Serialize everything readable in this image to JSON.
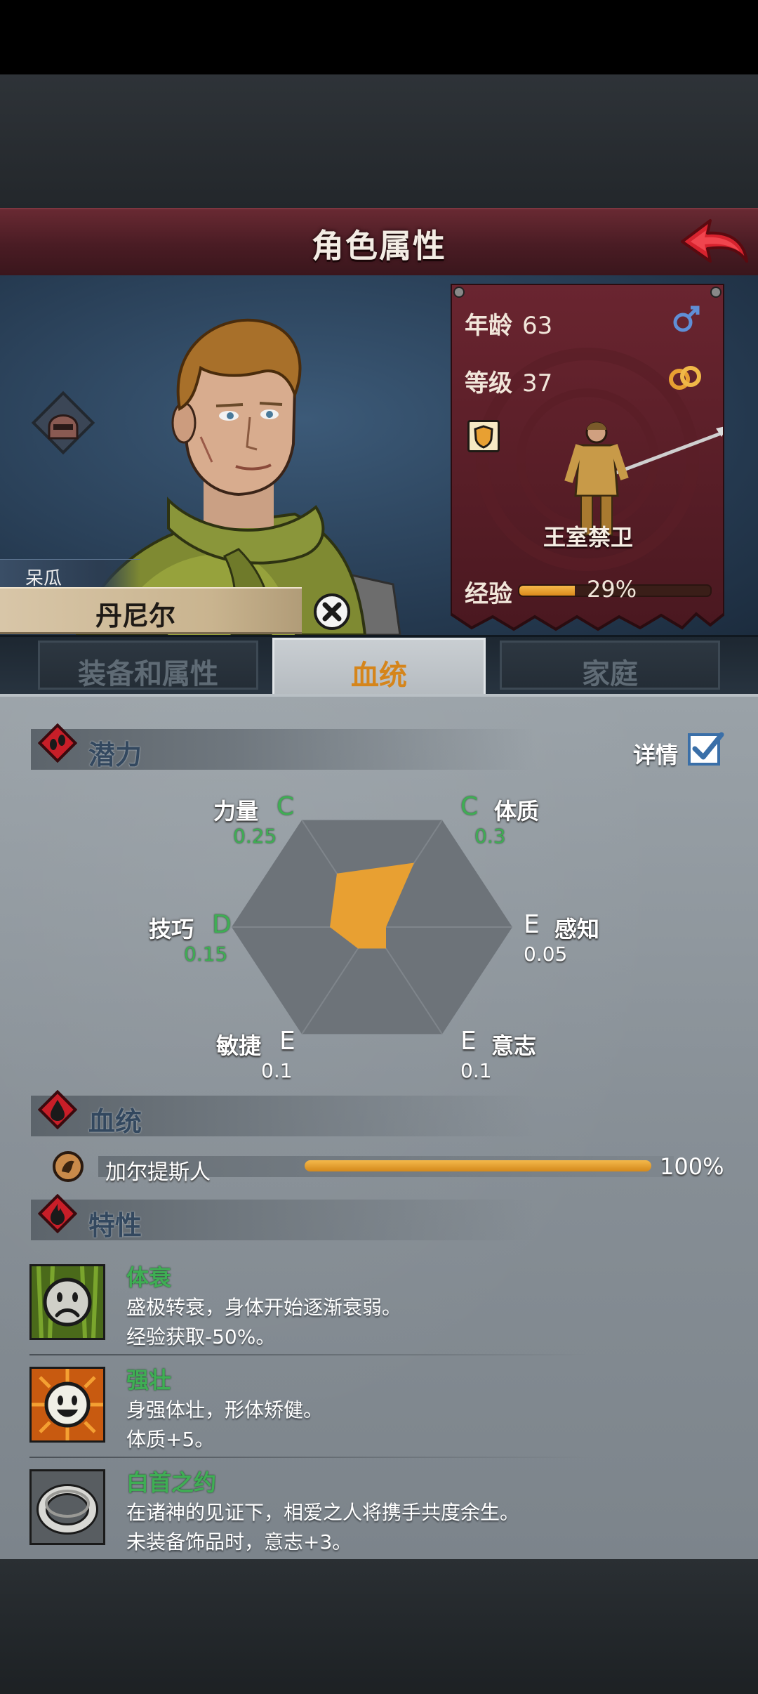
{
  "header": {
    "title": "角色属性",
    "back_icon": "red-arrow-back-icon"
  },
  "character": {
    "nickname": "呆瓜",
    "name": "丹尼尔",
    "age_label": "年龄",
    "age": "63",
    "gender_icon": "male-symbol-icon",
    "level_label": "等级",
    "level": "37",
    "ring_icon": "wedding-rings-icon",
    "class_name": "王室禁卫",
    "exp_label": "经验",
    "exp_percent": "29%",
    "exp_fraction": 0.29
  },
  "tabs": [
    {
      "label": "装备和属性",
      "active": false
    },
    {
      "label": "血统",
      "active": true
    },
    {
      "label": "家庭",
      "active": false
    }
  ],
  "potential": {
    "title": "潜力",
    "details_label": "详情",
    "details_checked": true,
    "stats": [
      {
        "name": "力量",
        "grade": "C",
        "value": "0.25"
      },
      {
        "name": "体质",
        "grade": "C",
        "value": "0.3"
      },
      {
        "name": "感知",
        "grade": "E",
        "value": "0.05"
      },
      {
        "name": "意志",
        "grade": "E",
        "value": "0.1"
      },
      {
        "name": "敏捷",
        "grade": "E",
        "value": "0.1"
      },
      {
        "name": "技巧",
        "grade": "D",
        "value": "0.15"
      }
    ]
  },
  "bloodline": {
    "title": "血统",
    "items": [
      {
        "name": "加尔提斯人",
        "percent": "100%",
        "fraction": 1.0
      }
    ]
  },
  "traits": {
    "title": "特性",
    "items": [
      {
        "name": "体衰",
        "lines": [
          "盛极转衰，身体开始逐渐衰弱。",
          "经验获取-50%。"
        ],
        "icon": "sad-face-icon"
      },
      {
        "name": "强壮",
        "lines": [
          "身强体壮，形体矫健。",
          "体质+5。"
        ],
        "icon": "happy-face-icon"
      },
      {
        "name": "白首之约",
        "lines": [
          "在诸神的见证下，相爱之人将携手共度余生。",
          "未装备饰品时，意志+3。"
        ],
        "icon": "ring-icon"
      }
    ]
  },
  "colors": {
    "title_bar": "#4a1c24",
    "accent_orange": "#e8a032",
    "grade_green": "#3fae54",
    "tab_active_text": "#d5851b"
  }
}
